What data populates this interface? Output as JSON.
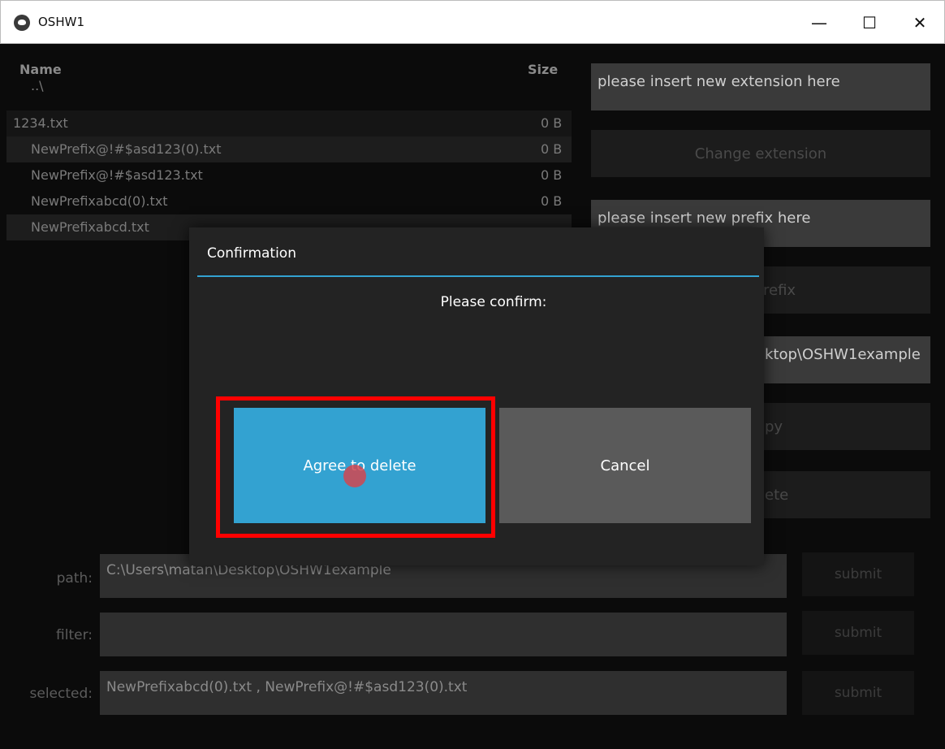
{
  "window": {
    "title": "OSHW1",
    "minimize_label": "—",
    "maximize_label": "☐",
    "close_label": "✕"
  },
  "filelist": {
    "header_name": "Name",
    "header_size": "Size",
    "rows": [
      {
        "name": "..\\",
        "size": ""
      },
      {
        "name": "1234.txt",
        "size": "0 B"
      },
      {
        "name": "NewPrefix@!#$asd123(0).txt",
        "size": "0 B"
      },
      {
        "name": "NewPrefix@!#$asd123.txt",
        "size": "0 B"
      },
      {
        "name": "NewPrefixabcd(0).txt",
        "size": "0 B"
      },
      {
        "name": "NewPrefixabcd.txt",
        "size": ""
      }
    ]
  },
  "right_panel": {
    "extension_input": "please insert new extension here",
    "change_extension": "Change extension",
    "prefix_input": "please insert new prefix here",
    "prefix_button_fragment": "refix",
    "path_fragment": "ktop\\OSHW1example",
    "copy_fragment": "py",
    "delete_fragment": "ete"
  },
  "bottom": {
    "path_label": "path:",
    "path_value": "C:\\Users\\matan\\Desktop\\OSHW1example",
    "filter_label": "filter:",
    "filter_value": "",
    "selected_label": "selected:",
    "selected_value": "NewPrefixabcd(0).txt , NewPrefix@!#$asd123(0).txt",
    "submit": "submit"
  },
  "modal": {
    "title": "Confirmation",
    "message": "Please confirm:",
    "agree": "Agree to delete",
    "cancel": "Cancel"
  },
  "colors": {
    "accent": "#33a2d1",
    "highlight": "#ff0000"
  }
}
